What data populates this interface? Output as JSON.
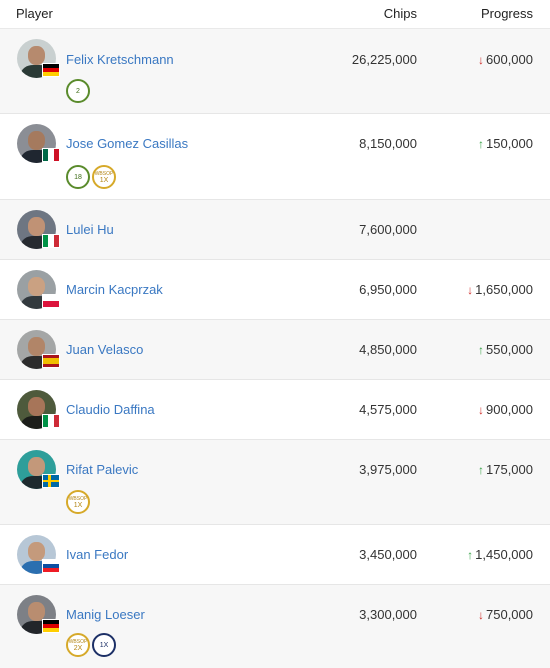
{
  "header": {
    "player": "Player",
    "chips": "Chips",
    "progress": "Progress"
  },
  "players": [
    {
      "name": "Felix Kretschmann",
      "chips": "26,225,000",
      "progress": "600,000",
      "direction": "down",
      "flag": "germany",
      "badges": [
        {
          "type": "green",
          "top": "",
          "bottom": "2"
        }
      ]
    },
    {
      "name": "Jose Gomez Casillas",
      "chips": "8,150,000",
      "progress": "150,000",
      "direction": "up",
      "flag": "mexico",
      "badges": [
        {
          "type": "green",
          "top": "",
          "bottom": "18"
        },
        {
          "type": "gold",
          "top": "WBSOP",
          "bottom": "1X"
        }
      ]
    },
    {
      "name": "Lulei Hu",
      "chips": "7,600,000",
      "progress": "",
      "direction": "",
      "flag": "italy",
      "badges": []
    },
    {
      "name": "Marcin Kacprzak",
      "chips": "6,950,000",
      "progress": "1,650,000",
      "direction": "down",
      "flag": "poland",
      "badges": []
    },
    {
      "name": "Juan Velasco",
      "chips": "4,850,000",
      "progress": "550,000",
      "direction": "up",
      "flag": "spain",
      "badges": []
    },
    {
      "name": "Claudio Daffina",
      "chips": "4,575,000",
      "progress": "900,000",
      "direction": "down",
      "flag": "italy",
      "badges": []
    },
    {
      "name": "Rifat Palevic",
      "chips": "3,975,000",
      "progress": "175,000",
      "direction": "up",
      "flag": "sweden",
      "badges": [
        {
          "type": "gold",
          "top": "WBSOP",
          "bottom": "1X"
        }
      ]
    },
    {
      "name": "Ivan Fedor",
      "chips": "3,450,000",
      "progress": "1,450,000",
      "direction": "up",
      "flag": "slovakia",
      "badges": []
    },
    {
      "name": "Manig Loeser",
      "chips": "3,300,000",
      "progress": "750,000",
      "direction": "down",
      "flag": "germany",
      "badges": [
        {
          "type": "gold",
          "top": "WBSOP",
          "bottom": "2X"
        },
        {
          "type": "navy",
          "top": "",
          "bottom": "1X"
        }
      ]
    }
  ],
  "arrows": {
    "up": "↑",
    "down": "↓"
  },
  "colors": {
    "link": "#3a78c2",
    "up": "#3aa34a",
    "down": "#d0302c",
    "row_alt": "#f7f7f7"
  }
}
